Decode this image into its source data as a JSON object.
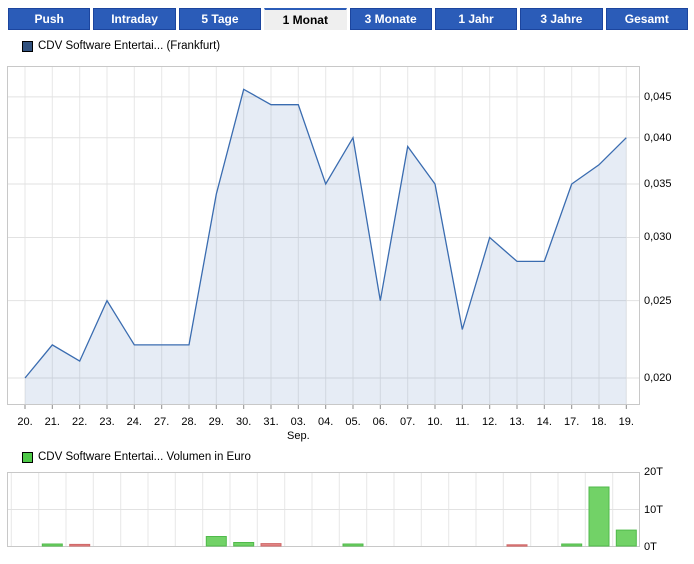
{
  "tabs": {
    "items": [
      {
        "label": "Push",
        "active": false
      },
      {
        "label": "Intraday",
        "active": false
      },
      {
        "label": "5 Tage",
        "active": false
      },
      {
        "label": "1 Monat",
        "active": true
      },
      {
        "label": "3 Monate",
        "active": false
      },
      {
        "label": "1 Jahr",
        "active": false
      },
      {
        "label": "3 Jahre",
        "active": false
      },
      {
        "label": "Gesamt",
        "active": false
      }
    ],
    "active_bg": "#efefef",
    "inactive_bg": "#2b5cb8"
  },
  "chart_data": [
    {
      "type": "area",
      "title": "CDV Software Entertai... (Frankfurt)",
      "legend_color": "#31517e",
      "x_categories": [
        "20.",
        "21.",
        "22.",
        "23.",
        "24.",
        "27.",
        "28.",
        "29.",
        "30.",
        "31.",
        "03.",
        "04.",
        "05.",
        "06.",
        "07.",
        "10.",
        "11.",
        "12.",
        "13.",
        "14.",
        "17.",
        "18.",
        "19."
      ],
      "month_label": "Sep.",
      "month_label_at": "03.",
      "values": [
        0.02,
        0.022,
        0.021,
        0.025,
        0.022,
        0.022,
        0.022,
        0.034,
        0.046,
        0.044,
        0.044,
        0.035,
        0.04,
        0.025,
        0.039,
        0.035,
        0.023,
        0.03,
        0.028,
        0.028,
        0.035,
        0.037,
        0.04
      ],
      "y_ticks": [
        0.045,
        0.04,
        0.035,
        0.03,
        0.025,
        0.02
      ],
      "y_tick_labels": [
        "0,045",
        "0,040",
        "0,035",
        "0,030",
        "0,025",
        "0,020"
      ],
      "y_scale": "log",
      "y_range": [
        0.0185,
        0.0492
      ],
      "grid": true,
      "line_color": "#3a6cb0",
      "fill_color": "rgba(58,108,176,0.13)"
    },
    {
      "type": "bar",
      "title": "CDV Software Entertai... Volumen in Euro",
      "legend_color": "#4ec948",
      "x_categories": [
        "20.",
        "21.",
        "22.",
        "23.",
        "24.",
        "27.",
        "28.",
        "29.",
        "30.",
        "31.",
        "03.",
        "04.",
        "05.",
        "06.",
        "07.",
        "10.",
        "11.",
        "12.",
        "13.",
        "14.",
        "17.",
        "18.",
        "19."
      ],
      "values_thousands": [
        0,
        0.8,
        0.7,
        0,
        0,
        0,
        0,
        2.8,
        1.2,
        0.9,
        0,
        0,
        0.8,
        0,
        0,
        0,
        0,
        0,
        0.6,
        0,
        0.8,
        16,
        4.5
      ],
      "directions": [
        "none",
        "up",
        "down",
        "none",
        "none",
        "none",
        "none",
        "up",
        "up",
        "down",
        "none",
        "none",
        "up",
        "none",
        "none",
        "none",
        "none",
        "none",
        "down",
        "none",
        "up",
        "up",
        "up"
      ],
      "y_ticks": [
        20,
        10,
        0
      ],
      "y_tick_labels": [
        "20T",
        "10T",
        "0T"
      ],
      "y_range": [
        0,
        20
      ],
      "grid": true,
      "up_color": "#72d267",
      "up_border": "#50ba4b",
      "down_color": "#e38787",
      "down_border": "#d06767"
    }
  ]
}
